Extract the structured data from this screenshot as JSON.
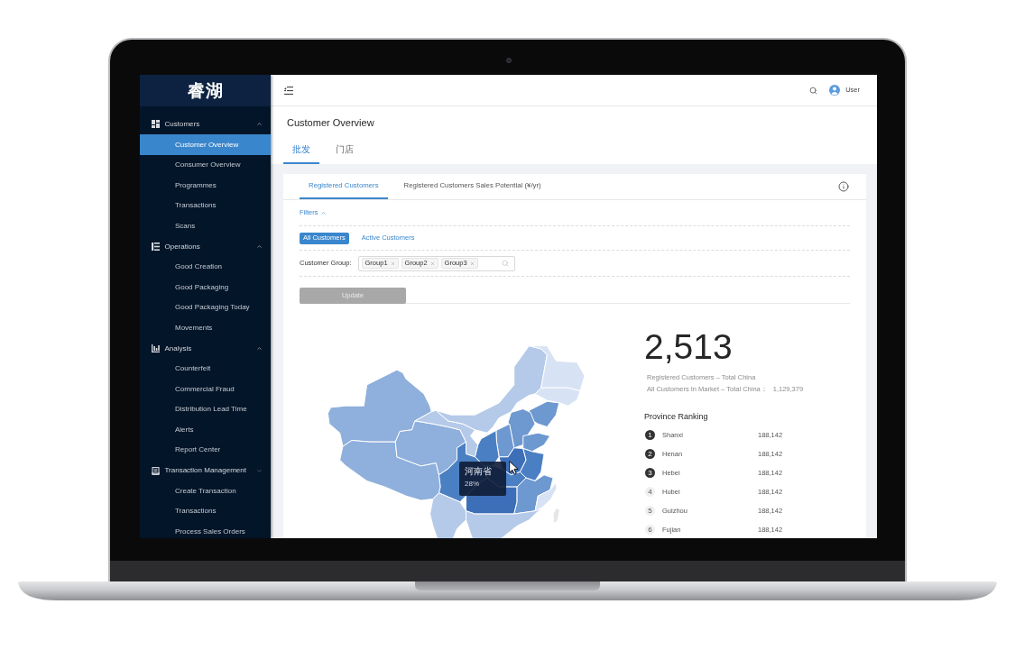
{
  "sidebar": {
    "logo": "睿湖",
    "groups": [
      {
        "label": "Customers",
        "expanded": true,
        "items": [
          {
            "label": "Customer Overview",
            "selected": true
          },
          {
            "label": "Consumer Overview",
            "selected": false
          },
          {
            "label": "Programmes",
            "selected": false
          },
          {
            "label": "Transactions",
            "selected": false
          },
          {
            "label": "Scans",
            "selected": false
          }
        ]
      },
      {
        "label": "Operations",
        "expanded": true,
        "items": [
          {
            "label": "Good Creation",
            "selected": false
          },
          {
            "label": "Good Packaging",
            "selected": false
          },
          {
            "label": "Good Packaging Today",
            "selected": false
          },
          {
            "label": "Movements",
            "selected": false
          }
        ]
      },
      {
        "label": "Analysis",
        "expanded": true,
        "items": [
          {
            "label": "Counterfeit",
            "selected": false
          },
          {
            "label": "Commercial Fraud",
            "selected": false
          },
          {
            "label": "Distribution Lead Time",
            "selected": false
          },
          {
            "label": "Alerts",
            "selected": false
          },
          {
            "label": "Report Center",
            "selected": false
          }
        ]
      },
      {
        "label": "Transaction Management",
        "expanded": false,
        "items": [
          {
            "label": "Create Transaction",
            "selected": false
          },
          {
            "label": "Transactions",
            "selected": false
          },
          {
            "label": "Process Sales Orders",
            "selected": false
          }
        ]
      }
    ]
  },
  "header": {
    "user": "User"
  },
  "page": {
    "title": "Customer Overview",
    "tabs": [
      {
        "label": "批发",
        "selected": true
      },
      {
        "label": "门店",
        "selected": false
      }
    ]
  },
  "card": {
    "tabs": [
      {
        "label": "Registered Customers",
        "selected": true
      },
      {
        "label": "Registered Customers Sales Potential (¥/yr)",
        "selected": false
      }
    ],
    "filters": {
      "label": "Filters",
      "expanded": true,
      "audience": [
        {
          "label": "All Customers",
          "selected": true
        },
        {
          "label": "Active Customers",
          "selected": false
        }
      ],
      "customer_group": {
        "label": "Customer Group:",
        "tags": [
          "Group1",
          "Group2",
          "Group3"
        ]
      },
      "update_button": {
        "label": "Update",
        "disabled": true
      }
    }
  },
  "map": {
    "tooltip": {
      "title": "河南省",
      "value": "28%"
    }
  },
  "summary": {
    "total": "2,513",
    "caption": "Registered Customers – Total China",
    "market_label": "All Customers In Market – Total China：",
    "market_value": "1,129,379"
  },
  "ranking": {
    "title": "Province Ranking",
    "rows": [
      {
        "rank": "1",
        "name": "Shanxi",
        "value": "188,142",
        "highlighted": true
      },
      {
        "rank": "2",
        "name": "Henan",
        "value": "188,142",
        "highlighted": true
      },
      {
        "rank": "3",
        "name": "Hebei",
        "value": "188,142",
        "highlighted": true
      },
      {
        "rank": "4",
        "name": "Hubei",
        "value": "188,142",
        "highlighted": false
      },
      {
        "rank": "5",
        "name": "Guizhou",
        "value": "188,142",
        "highlighted": false
      },
      {
        "rank": "6",
        "name": "Fujian",
        "value": "188,142",
        "highlighted": false
      }
    ]
  }
}
